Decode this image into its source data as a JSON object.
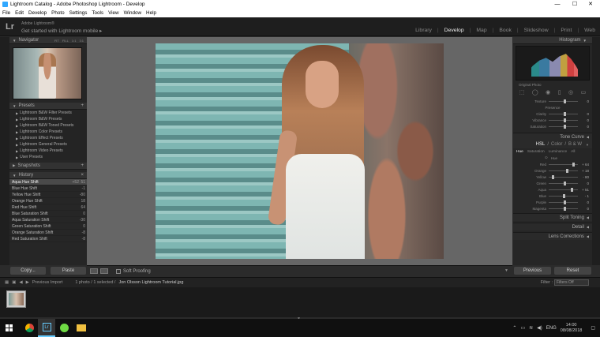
{
  "window": {
    "title": "Lightroom Catalog - Adobe Photoshop Lightroom - Develop",
    "minimize": "—",
    "maximize": "☐",
    "close": "✕"
  },
  "menu": [
    "File",
    "Edit",
    "Develop",
    "Photo",
    "Settings",
    "Tools",
    "View",
    "Window",
    "Help"
  ],
  "identity": {
    "logo": "Lr",
    "line1": "Adobe Lightroom®",
    "line2": "Get started with Lightroom mobile ▸"
  },
  "modules": [
    {
      "label": "Library"
    },
    {
      "label": "Develop",
      "active": true
    },
    {
      "label": "Map"
    },
    {
      "label": "Book"
    },
    {
      "label": "Slideshow"
    },
    {
      "label": "Print"
    },
    {
      "label": "Web"
    }
  ],
  "navigator": {
    "title": "Navigator",
    "options": [
      "FIT",
      "FILL",
      "1:1",
      "3:1"
    ]
  },
  "presets": {
    "title": "Presets",
    "items": [
      "Lightroom B&W Filter Presets",
      "Lightroom B&W Presets",
      "Lightroom B&W Toned Presets",
      "Lightroom Color Presets",
      "Lightroom Effect Presets",
      "Lightroom General Presets",
      "Lightroom Video Presets",
      "User Presets"
    ]
  },
  "snapshots": {
    "title": "Snapshots"
  },
  "history": {
    "title": "History",
    "items": [
      {
        "label": "Aqua Hue Shift",
        "v1": "+52",
        "v2": "51",
        "selected": true
      },
      {
        "label": "Blue Hue Shift",
        "v1": "",
        "v2": "-1"
      },
      {
        "label": "Yellow Hue Shift",
        "v1": "",
        "v2": "-80"
      },
      {
        "label": "Orange Hue Shift",
        "v1": "",
        "v2": "18"
      },
      {
        "label": "Red Hue Shift",
        "v1": "",
        "v2": "64"
      },
      {
        "label": "Blue Saturation Shift",
        "v1": "",
        "v2": "0"
      },
      {
        "label": "Aqua Saturation Shift",
        "v1": "",
        "v2": "-30"
      },
      {
        "label": "Green Saturation Shift",
        "v1": "",
        "v2": "0"
      },
      {
        "label": "Orange Saturation Shift",
        "v1": "",
        "v2": "-8"
      },
      {
        "label": "Red Saturation Shift",
        "v1": "",
        "v2": "-8"
      }
    ]
  },
  "left_buttons": {
    "copy": "Copy...",
    "paste": "Paste"
  },
  "toolbar": {
    "soft_proofing": "Soft Proofing"
  },
  "histogram": {
    "title": "Histogram",
    "original": "Original Photo"
  },
  "presence": {
    "rows_top": [
      {
        "name": "Texture",
        "value": "0"
      }
    ],
    "heading": "Presence",
    "rows": [
      {
        "name": "Clarity",
        "value": "0"
      },
      {
        "name": "Vibrance",
        "value": "0"
      },
      {
        "name": "Saturation",
        "value": "0"
      }
    ]
  },
  "sections": {
    "tone_curve": "Tone Curve",
    "split_toning": "Split Toning",
    "detail": "Detail",
    "lens": "Lens Corrections"
  },
  "hsl": {
    "tabs": [
      "HSL",
      "/",
      "Color",
      "/",
      "B & W"
    ],
    "subtabs": [
      "Hue",
      "Saturation",
      "Luminance",
      "All"
    ],
    "heading": "Hue",
    "rows": [
      {
        "name": "Red",
        "value": "+ 64",
        "pos": 0.82
      },
      {
        "name": "Orange",
        "value": "+ 18",
        "pos": 0.59
      },
      {
        "name": "Yellow",
        "value": "- 80",
        "pos": 0.1
      },
      {
        "name": "Green",
        "value": "0",
        "pos": 0.5
      },
      {
        "name": "Aqua",
        "value": "+ 51",
        "pos": 0.75
      },
      {
        "name": "Blue",
        "value": "- 1",
        "pos": 0.49
      },
      {
        "name": "Purple",
        "value": "0",
        "pos": 0.5
      },
      {
        "name": "Magenta",
        "value": "0",
        "pos": 0.5
      }
    ]
  },
  "right_buttons": {
    "previous": "Previous",
    "reset": "Reset"
  },
  "filmstrip": {
    "source": "Previous Import",
    "count": "1 photo / 1 selected /",
    "filename": "Jon Olsson Lightroom Tutorial.jpg",
    "filter_label": "Filter :",
    "filter_value": "Filters Off"
  },
  "taskbar": {
    "lang": "ENG",
    "time": "14:00",
    "date": "08/08/2018"
  }
}
